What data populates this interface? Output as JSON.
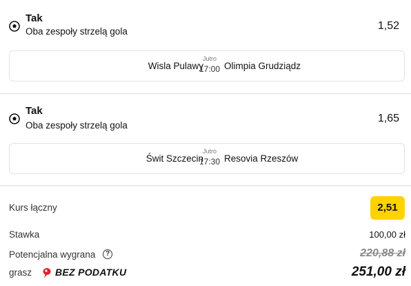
{
  "bets": [
    {
      "selection": "Tak",
      "market": "Oba zespoły strzelą gola",
      "odds": "1,52",
      "icon": "soccer-ball-icon",
      "match": {
        "home": "Wisla Pulawy",
        "away": "Olimpia Grudziądz",
        "day": "Jutro",
        "time": "17:00"
      }
    },
    {
      "selection": "Tak",
      "market": "Oba zespoły strzelą gola",
      "odds": "1,65",
      "icon": "soccer-ball-icon",
      "match": {
        "home": "Świt Szczecin",
        "away": "Resovia Rzeszów",
        "day": "Jutro",
        "time": "17:30"
      }
    }
  ],
  "summary": {
    "total_odds_label": "Kurs łączny",
    "total_odds": "2,51",
    "stake_label": "Stawka",
    "stake": "100,00 zł",
    "potential_win_label": "Potencjalna wygrana",
    "potential_win_old": "220,88 zł",
    "gross_label": "grasz",
    "promo_label": "BEZ PODATKU",
    "potential_win_new": "251,00 zł"
  },
  "colors": {
    "accent": "#ffd200",
    "promo_red": "#e4202c",
    "border": "#e2e2e2"
  }
}
